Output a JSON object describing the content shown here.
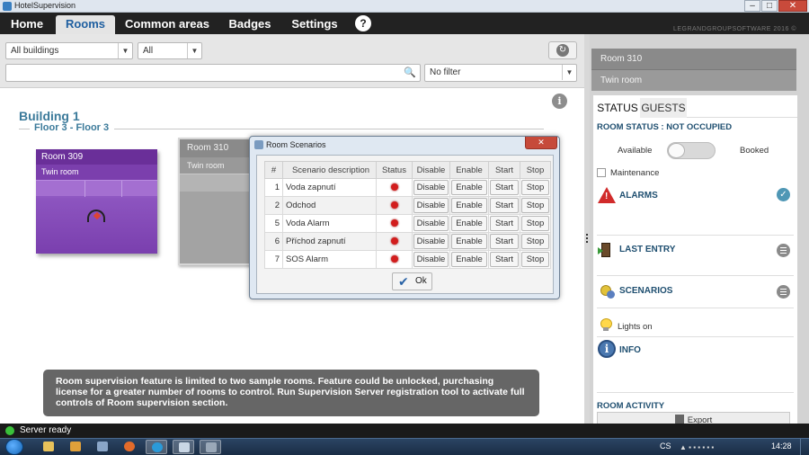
{
  "window": {
    "title": "HotelSupervision",
    "min_label": "–",
    "max_label": "□",
    "close_label": "✕"
  },
  "nav": {
    "tabs": [
      {
        "label": "Home",
        "active": false
      },
      {
        "label": "Rooms",
        "active": true
      },
      {
        "label": "Common areas",
        "active": false
      },
      {
        "label": "Badges",
        "active": false
      },
      {
        "label": "Settings",
        "active": false
      }
    ],
    "help_label": "?",
    "brand": "LEGRANDGROUPSOFTWARE 2016 ©"
  },
  "toolbar": {
    "buildings_select": "All buildings",
    "floor_select": "All",
    "search_value": "",
    "filter_select": "No filter",
    "dropdown_arrow": "▼",
    "refresh_icon": "↻",
    "search_icon": "🔍"
  },
  "main": {
    "info_label": "i",
    "building_title": "Building 1",
    "floor_title": "Floor 3 - Floor 3",
    "rooms": [
      {
        "name": "Room 309",
        "type": "Twin room",
        "color": "#8f57c2"
      },
      {
        "name": "Room 310",
        "type": "Twin room",
        "color": "#a3a3a3"
      }
    ],
    "banner": "Room supervision feature is limited to two sample rooms. Feature could be unlocked, purchasing license for a greater number of rooms to control. Run Supervision Server registration tool to activate full controls of Room supervision section."
  },
  "dialog": {
    "title": "Room Scenarios",
    "close_label": "✕",
    "columns": [
      "#",
      "Scenario description",
      "Status",
      "Disable",
      "Enable",
      "Start",
      "Stop"
    ],
    "rows": [
      {
        "num": "1",
        "desc": "Voda zapnutí"
      },
      {
        "num": "2",
        "desc": "Odchod"
      },
      {
        "num": "5",
        "desc": "Voda Alarm"
      },
      {
        "num": "6",
        "desc": "Příchod zapnutí"
      },
      {
        "num": "7",
        "desc": "SOS Alarm"
      }
    ],
    "btn_disable": "Disable",
    "btn_enable": "Enable",
    "btn_start": "Start",
    "btn_stop": "Stop",
    "status_color": "#d21d1d",
    "ok_label": "Ok",
    "ok_icon": "✔"
  },
  "panel": {
    "room_name": "Room 310",
    "room_type": "Twin room",
    "tabs": {
      "status": "STATUS",
      "guests": "GUESTS"
    },
    "room_status": "ROOM STATUS : NOT OCCUPIED",
    "available_label": "Available",
    "booked_label": "Booked",
    "maintenance_label": "Maintenance",
    "alarms_title": "ALARMS",
    "alarm_icon_glyph": "!",
    "alarms_check": "✓",
    "last_entry_title": "LAST ENTRY",
    "scenarios_title": "SCENARIOS",
    "lights_label": "Lights on",
    "info_title": "INFO",
    "info_glyph": "i",
    "activity_title": "ROOM ACTIVITY",
    "export_label": "Export"
  },
  "status": {
    "text": "Server ready"
  },
  "taskbar": {
    "lang": "CS",
    "clock": "14:28"
  }
}
